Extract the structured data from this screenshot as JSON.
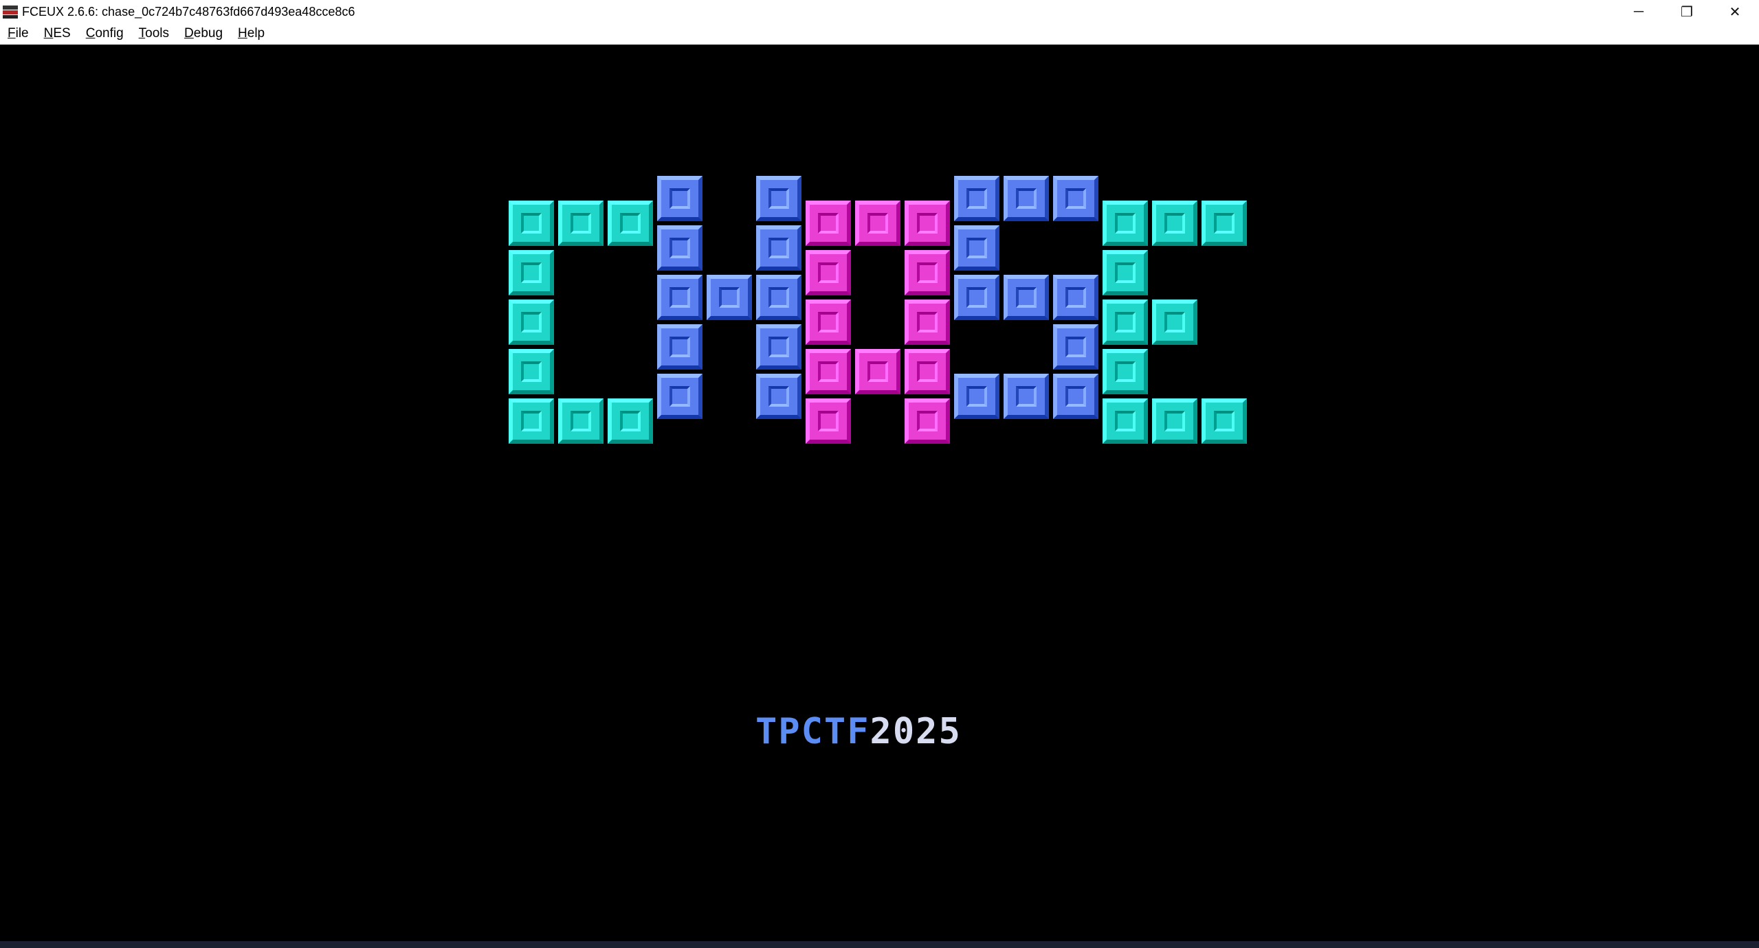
{
  "window": {
    "title": "FCEUX 2.6.6: chase_0c724b7c48763fd667d493ea48cce8c6",
    "controls": {
      "minimize": "─",
      "restore": "❐",
      "close": "✕"
    }
  },
  "menu": [
    {
      "mnemonic": "F",
      "rest": "ile"
    },
    {
      "mnemonic": "N",
      "rest": "ES"
    },
    {
      "mnemonic": "C",
      "rest": "onfig"
    },
    {
      "mnemonic": "T",
      "rest": "ools"
    },
    {
      "mnemonic": "D",
      "rest": "ebug"
    },
    {
      "mnemonic": "H",
      "rest": "elp"
    }
  ],
  "game": {
    "subtitle_part1": "TPCTF",
    "subtitle_part2": "2025",
    "colors": {
      "cyan": "#1fd6c8",
      "blue": "#5a7ef0",
      "magenta": "#e93fd3",
      "subtitle_blue": "#5b8df5",
      "subtitle_white": "#d8dcf0"
    }
  }
}
